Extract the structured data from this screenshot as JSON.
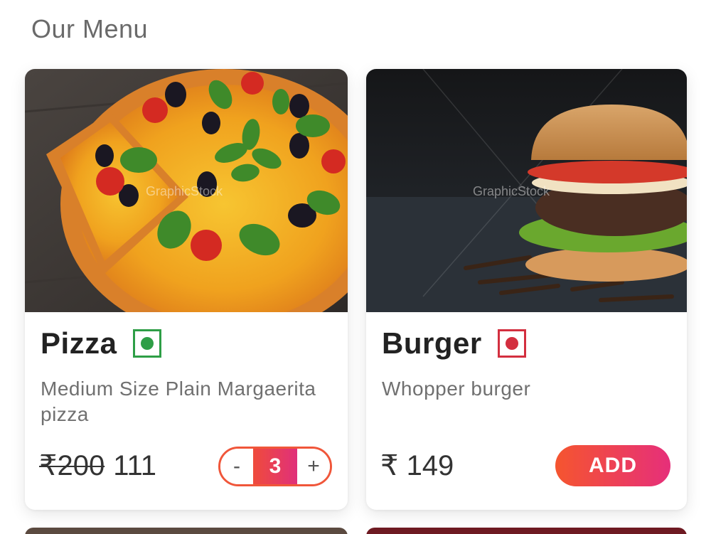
{
  "section": {
    "title": "Our Menu"
  },
  "items": [
    {
      "name": "Pizza",
      "diet_icon": "veg-mark-icon",
      "description": "Medium Size Plain Margaerita pizza",
      "old_price": "₹200",
      "new_price": "111",
      "quantity": "3",
      "minus_label": "-",
      "plus_label": "+",
      "image_watermark": "GraphicStock"
    },
    {
      "name": "Burger",
      "diet_icon": "non-veg-mark-icon",
      "description": "Whopper burger",
      "price": "₹ 149",
      "add_label": "ADD",
      "image_watermark": "GraphicStock"
    }
  ],
  "colors": {
    "accent_start": "#f5552f",
    "accent_end": "#e62f7a",
    "veg": "#2e9e46",
    "non_veg": "#d32f3f"
  }
}
